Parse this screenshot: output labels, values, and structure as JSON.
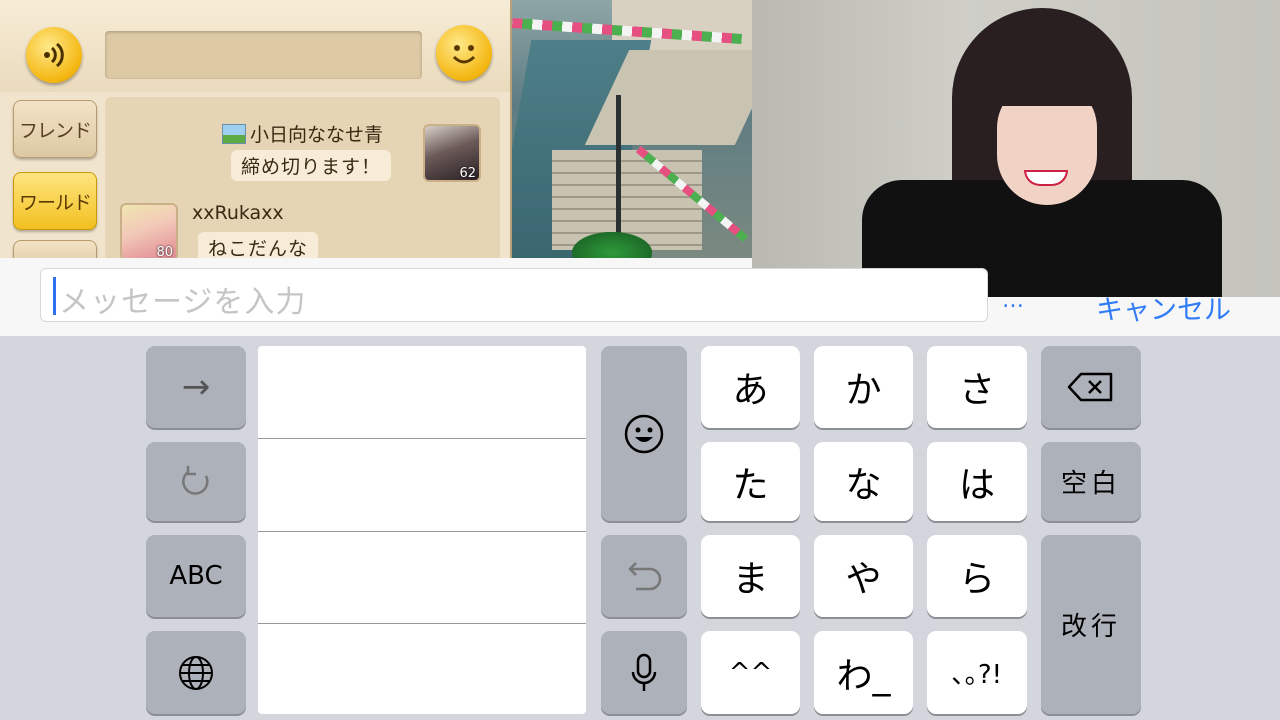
{
  "game_chat": {
    "tabs": [
      "フレンド",
      "ワールド"
    ],
    "active_tab": "ワールド",
    "messages": [
      {
        "name": "小日向ななせ青",
        "text": "締め切ります！",
        "level": "62"
      },
      {
        "name": "xxRukaxx",
        "text": "ねこだんな",
        "level": "80"
      }
    ],
    "voice_icon": "speaker-waves-icon",
    "emoji_icon": "smiley-icon"
  },
  "message_input": {
    "placeholder": "メッセージを入力",
    "more": "…",
    "cancel": "キャンセル"
  },
  "keyboard": {
    "left_keys": [
      "→",
      "↺",
      "ABC",
      "globe-icon"
    ],
    "kana_rows": [
      [
        "あ",
        "か",
        "さ"
      ],
      [
        "た",
        "な",
        "は"
      ],
      [
        "ま",
        "や",
        "ら"
      ],
      [
        "^^",
        "わ_",
        "､｡?!"
      ]
    ],
    "right_keys": {
      "delete": "delete-icon",
      "space": "空白",
      "return": "改行"
    },
    "middle_keys": [
      "emoji-icon",
      "undo-icon",
      "mic-icon"
    ]
  },
  "colors": {
    "accent": "#2f7cf6",
    "game_panel": "#f0e4cc",
    "tab_active": "#f2c020"
  }
}
